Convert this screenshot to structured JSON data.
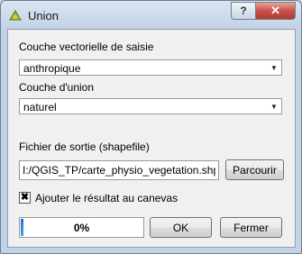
{
  "window": {
    "title": "Union"
  },
  "titlebar": {
    "help_label": "?",
    "close_label": "✕"
  },
  "form": {
    "input_layer_label": "Couche vectorielle de saisie",
    "input_layer_value": "anthropique",
    "union_layer_label": "Couche d'union",
    "union_layer_value": "naturel",
    "output_label": "Fichier de sortie (shapefile)",
    "output_value": "I:/QGIS_TP/carte_physio_vegetation.shp",
    "browse_label": "Parcourir",
    "add_result_label": "Ajouter le résultat au canevas",
    "add_result_checked": true
  },
  "progress": {
    "value": 0,
    "text": "0%"
  },
  "buttons": {
    "ok_label": "OK",
    "close_label": "Fermer"
  },
  "icons": {
    "app": "qgis-icon",
    "dropdown": "chevron-down-icon",
    "check": "check-icon"
  }
}
